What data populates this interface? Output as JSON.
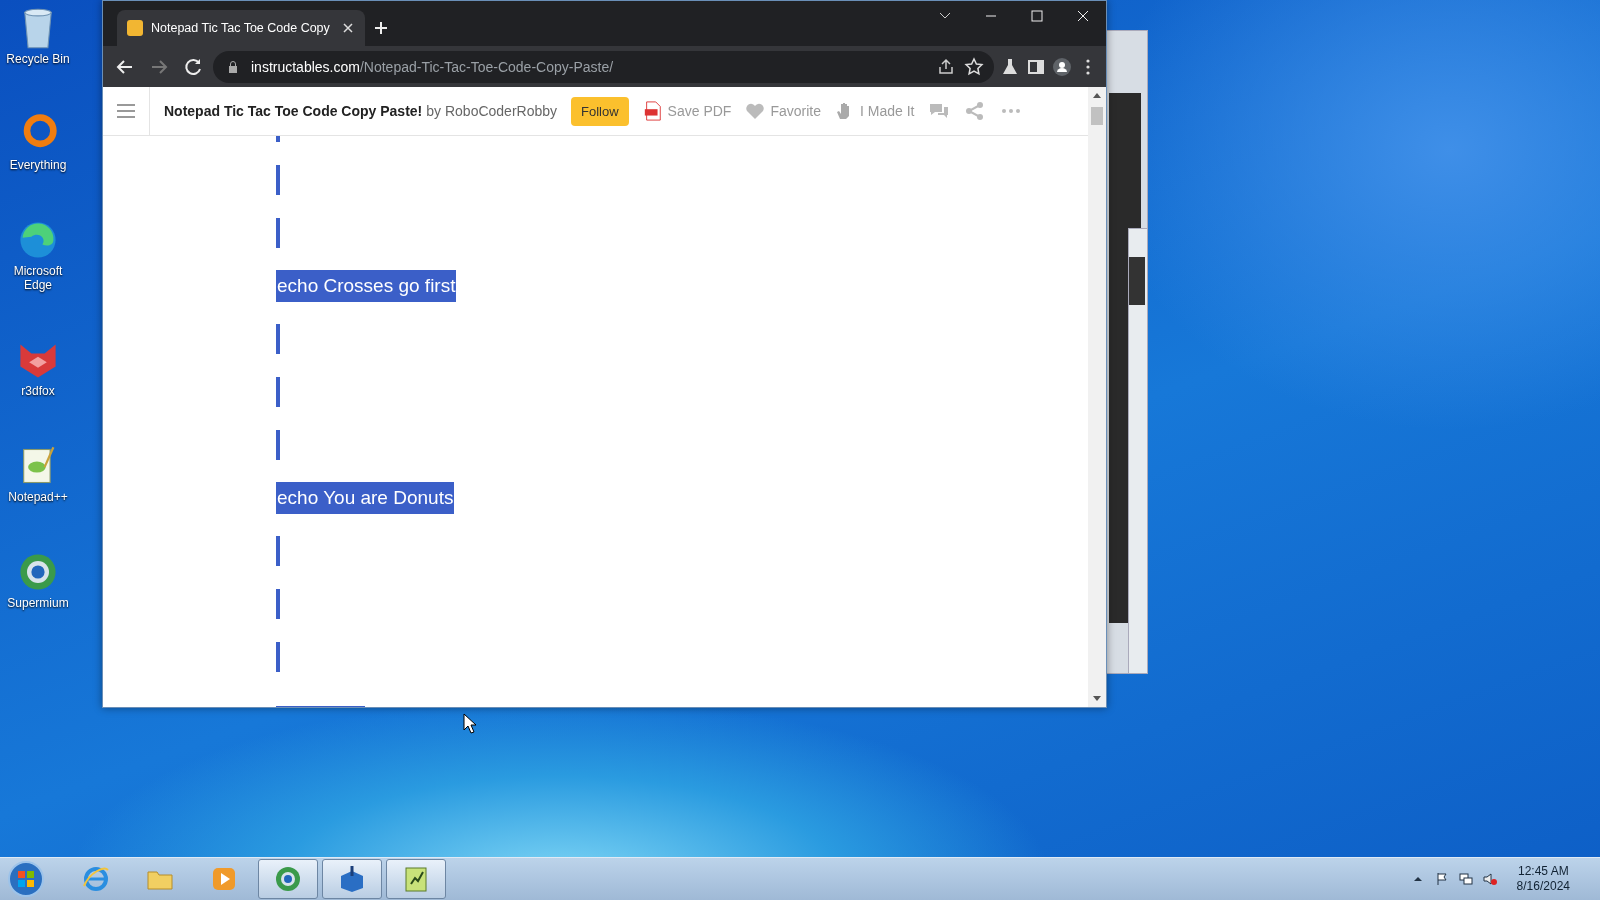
{
  "desktop_icons": [
    {
      "label": "Recycle Bin",
      "kind": "bin"
    },
    {
      "label": "Everything",
      "kind": "ring"
    },
    {
      "label": "Microsoft Edge",
      "kind": "edge"
    },
    {
      "label": "r3dfox",
      "kind": "fox"
    },
    {
      "label": "Notepad++",
      "kind": "notepad"
    },
    {
      "label": "Supermium",
      "kind": "globe"
    }
  ],
  "browser": {
    "tab": {
      "title": "Notepad Tic Tac Toe Code Copy",
      "selected": true
    },
    "address": {
      "domain": "instructables.com",
      "path": "/Notepad-Tic-Tac-Toe-Code-Copy-Paste/"
    },
    "page_toolbar": {
      "title": "Notepad Tic Tac Toe Code Copy Paste!",
      "byline": "by RoboCoderRobby",
      "follow": "Follow",
      "actions": [
        {
          "label": "Save PDF",
          "kind": "pdf"
        },
        {
          "label": "Favorite",
          "kind": "heart"
        },
        {
          "label": "I Made It",
          "kind": "hand"
        }
      ]
    },
    "lines": [
      {
        "kind": "blank"
      },
      {
        "kind": "blank"
      },
      {
        "kind": "blank"
      },
      {
        "kind": "text",
        "text": "echo Crosses go first"
      },
      {
        "kind": "blank"
      },
      {
        "kind": "blank"
      },
      {
        "kind": "blank"
      },
      {
        "kind": "text",
        "text": "echo You are Donuts"
      },
      {
        "kind": "blank"
      },
      {
        "kind": "blank"
      },
      {
        "kind": "blank"
      },
      {
        "kind": "cut"
      }
    ]
  },
  "taskbar": {
    "items": [
      {
        "kind": "ie",
        "running": false
      },
      {
        "kind": "folder",
        "running": false
      },
      {
        "kind": "media",
        "running": false
      },
      {
        "kind": "globe",
        "running": true
      },
      {
        "kind": "box",
        "running": true
      },
      {
        "kind": "notepad",
        "running": true
      }
    ],
    "time": "12:45 AM",
    "date": "8/16/2024"
  }
}
